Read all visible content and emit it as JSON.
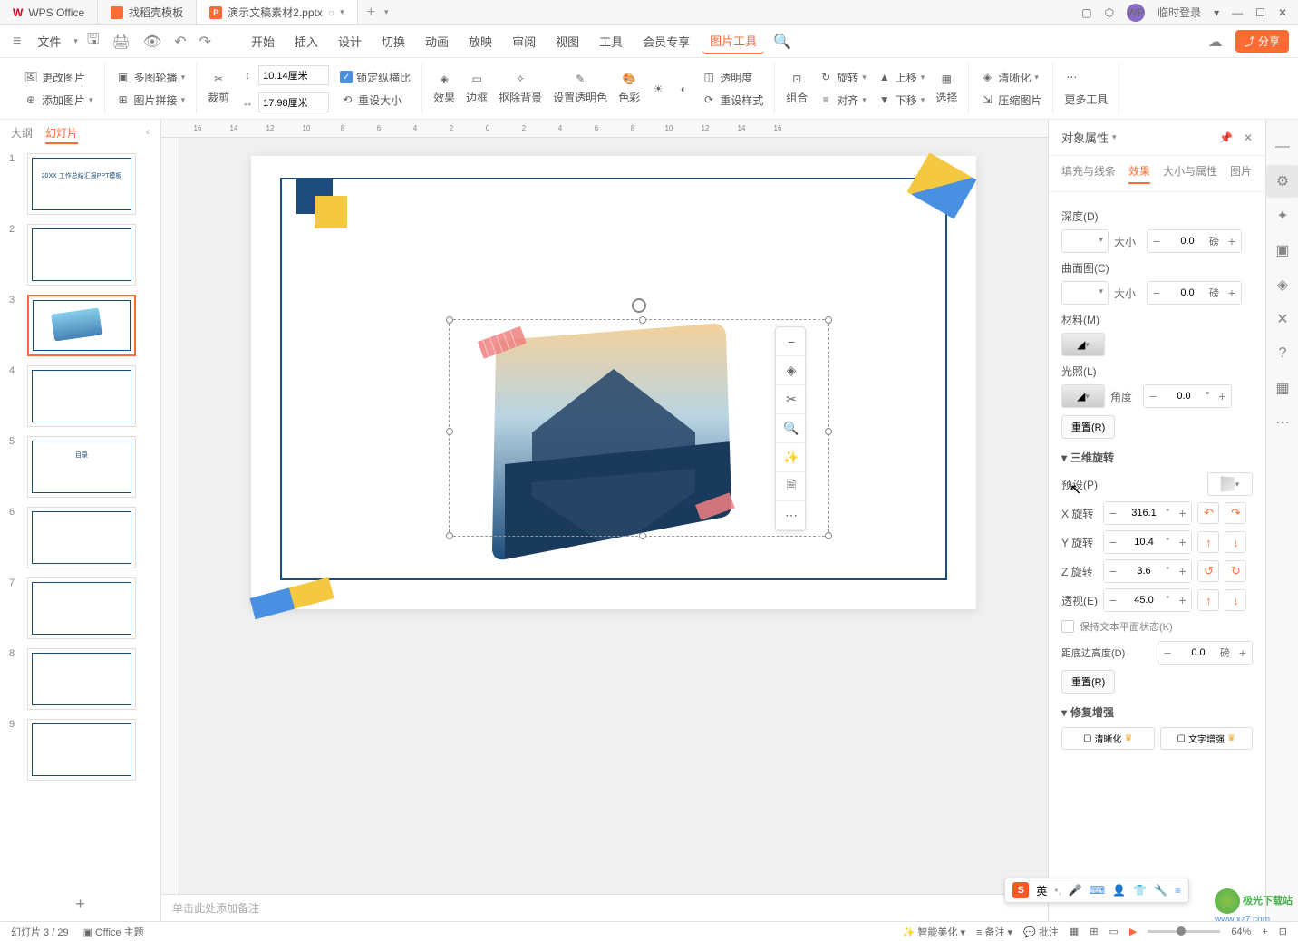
{
  "titlebar": {
    "tabs": [
      {
        "icon": "wps",
        "label": "WPS Office"
      },
      {
        "icon": "dk",
        "label": "找稻壳模板"
      },
      {
        "icon": "ppt",
        "label": "演示文稿素材2.pptx"
      }
    ],
    "login": "临时登录"
  },
  "menubar": {
    "file": "文件",
    "items": [
      "开始",
      "插入",
      "设计",
      "切换",
      "动画",
      "放映",
      "审阅",
      "视图",
      "工具",
      "会员专享"
    ],
    "active": "图片工具",
    "share": "分享"
  },
  "ribbon": {
    "change_image": "更改图片",
    "multi_outline": "多图轮播",
    "add_image": "添加图片",
    "image_stitch": "图片拼接",
    "crop": "裁剪",
    "width": "10.14厘米",
    "height": "17.98厘米",
    "lock_ratio": "锁定纵横比",
    "reset_size": "重设大小",
    "effect": "效果",
    "border": "边框",
    "remove_bg": "抠除背景",
    "set_transparent": "设置透明色",
    "color": "色彩",
    "transparency": "透明度",
    "reset_style": "重设样式",
    "group": "组合",
    "rotate": "旋转",
    "align": "对齐",
    "up": "上移",
    "down": "下移",
    "select": "选择",
    "sharpen": "清晰化",
    "compress": "压缩图片",
    "more_tools": "更多工具"
  },
  "slide_panel": {
    "tab_outline": "大纲",
    "tab_slides": "幻灯片",
    "thumbs": {
      "1": "20XX 工作总结汇报PPT模板",
      "5": "目录"
    }
  },
  "canvas": {
    "notes_placeholder": "单击此处添加备注"
  },
  "right_panel": {
    "title": "对象属性",
    "tabs": {
      "fill": "填充与线条",
      "effect": "效果",
      "size": "大小与属性",
      "image": "图片"
    },
    "depth": {
      "label": "深度(D)",
      "size_label": "大小",
      "value": "0.0",
      "unit": "磅"
    },
    "contour": {
      "label": "曲面图(C)",
      "size_label": "大小",
      "value": "0.0",
      "unit": "磅"
    },
    "material": {
      "label": "材料(M)"
    },
    "lighting": {
      "label": "光照(L)",
      "angle_label": "角度",
      "value": "0.0",
      "unit": "°"
    },
    "reset1": "重置(R)",
    "rotation3d": {
      "header": "三维旋转",
      "preset": "预设(P)",
      "x": {
        "label": "X 旋转",
        "value": "316.1",
        "unit": "°"
      },
      "y": {
        "label": "Y 旋转",
        "value": "10.4",
        "unit": "°"
      },
      "z": {
        "label": "Z 旋转",
        "value": "3.6",
        "unit": "°"
      },
      "perspective": {
        "label": "透视(E)",
        "value": "45.0",
        "unit": "°"
      },
      "keep_text_flat": "保持文本平面状态(K)",
      "distance": {
        "label": "距底边高度(D)",
        "value": "0.0",
        "unit": "磅"
      },
      "reset": "重置(R)"
    },
    "repair": {
      "header": "修复增强",
      "sharpen": "清晰化",
      "text_enhance": "文字增强"
    }
  },
  "statusbar": {
    "slide_info": "幻灯片 3 / 29",
    "theme": "Office 主题",
    "beautify": "智能美化",
    "notes": "备注",
    "comments": "批注",
    "zoom": "64%"
  },
  "ime": {
    "lang": "英"
  },
  "watermark": {
    "site": "极光下载站",
    "url": "www.xz7.com"
  }
}
